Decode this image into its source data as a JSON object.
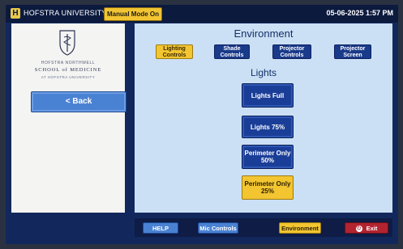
{
  "header": {
    "brand": "HOFSTRA UNIVERSITY.",
    "logo_letter": "H",
    "manual_mode": "Manual Mode On",
    "datetime": "05-06-2025 1:57 PM"
  },
  "sidebar": {
    "school_line1": "HOFSTRA NORTHWELL",
    "school_line2": "SCHOOL of MEDICINE",
    "school_line3": "AT HOFSTRA UNIVERSITY",
    "back_label": "< Back"
  },
  "main": {
    "title": "Environment",
    "tabs": [
      {
        "label": "Lighting Controls",
        "active": true
      },
      {
        "label": "Shade Controls",
        "active": false
      },
      {
        "label": "Projector Controls",
        "active": false
      },
      {
        "label": "Projector Screen",
        "active": false
      }
    ],
    "section_title": "Lights",
    "buttons": [
      {
        "label": "Lights Full",
        "active": false
      },
      {
        "label": "Lights 75%",
        "active": false
      },
      {
        "label": "Perimeter Only 50%",
        "active": false
      },
      {
        "label": "Perimeter Only 25%",
        "active": true
      }
    ]
  },
  "footer": {
    "help": "HELP",
    "mic": "Mic Controls",
    "environment": "Environment",
    "exit": "Exit"
  },
  "colors": {
    "accent_gold": "#f2c531",
    "button_blue": "#1a3e98",
    "panel_light_blue": "#cbe0f4",
    "exit_red": "#b22430"
  }
}
